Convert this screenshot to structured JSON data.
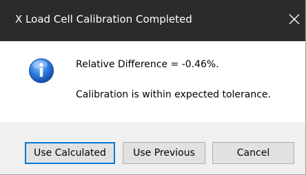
{
  "dialog": {
    "title": "X Load Cell Calibration Completed",
    "close_icon": "close-icon",
    "icon": "info-icon",
    "message_line1": "Relative Difference = -0.46%.",
    "message_line2": "Calibration is within expected tolerance."
  },
  "buttons": {
    "use_calculated": "Use Calculated",
    "use_previous": "Use Previous",
    "cancel": "Cancel"
  },
  "colors": {
    "titlebar": "#2b2b2b",
    "footer": "#f0f0f0",
    "default_button_border": "#0078d7",
    "info_icon_blue": "#1f5fbd"
  }
}
